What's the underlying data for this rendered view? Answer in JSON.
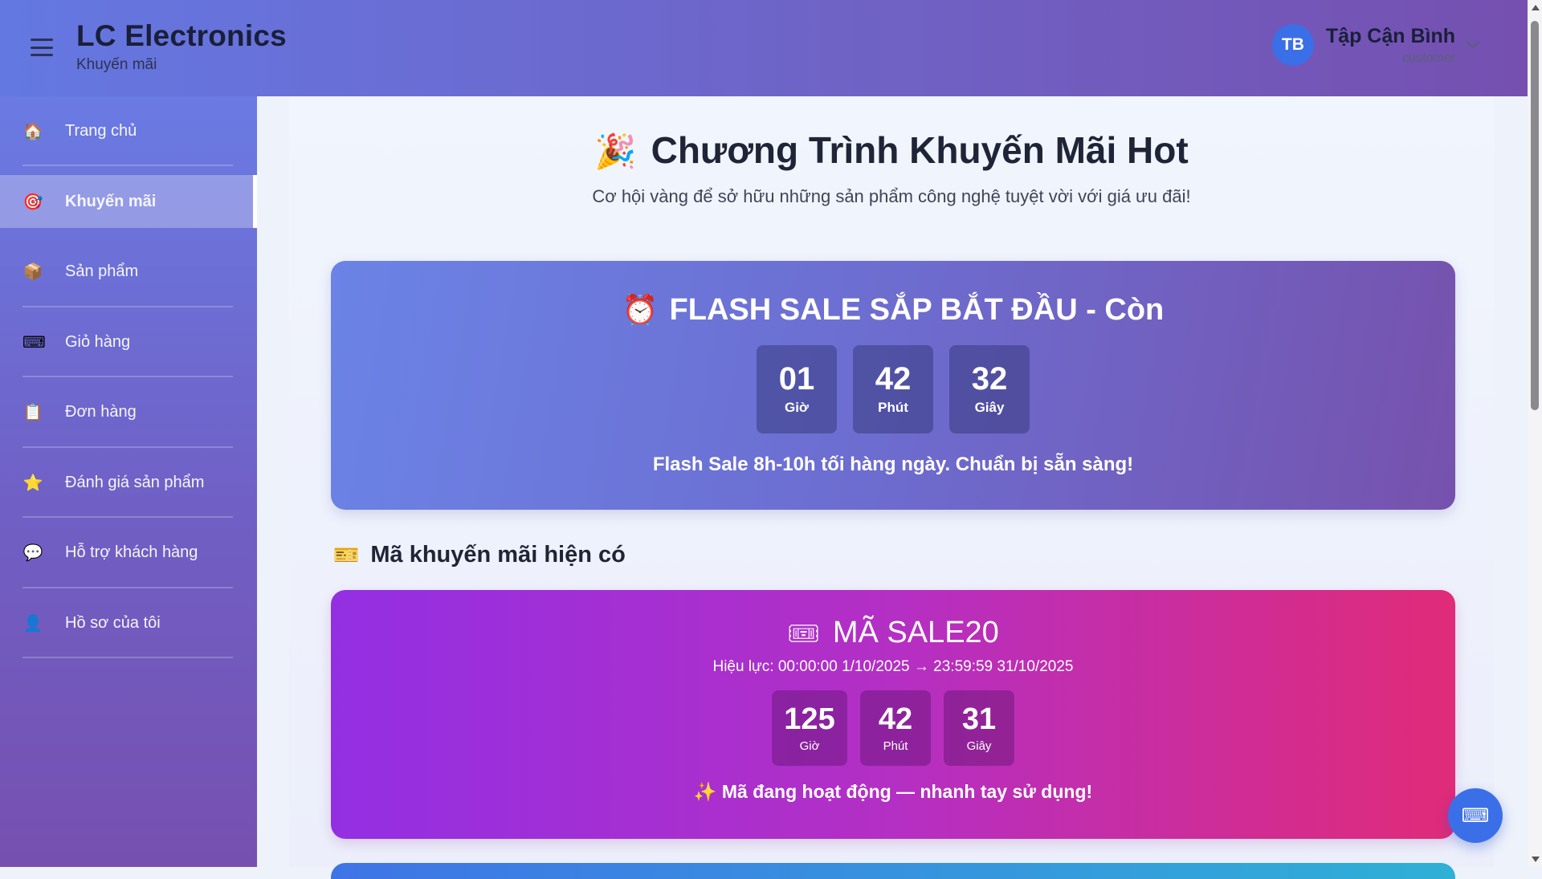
{
  "header": {
    "brand_title": "LC Electronics",
    "brand_subtitle": "Khuyến mãi",
    "user": {
      "initials": "TB",
      "name": "Tập Cận Bình",
      "role": "customer"
    }
  },
  "sidebar": {
    "items": [
      {
        "label": "Trang chủ",
        "icon": "🏠",
        "active": false
      },
      {
        "label": "Khuyến mãi",
        "icon": "🎯",
        "active": true
      },
      {
        "label": "Sản phẩm",
        "icon": "📦",
        "active": false
      },
      {
        "label": "Giỏ hàng",
        "icon": "⌨",
        "active": false
      },
      {
        "label": "Đơn hàng",
        "icon": "📋",
        "active": false
      },
      {
        "label": "Đánh giá sản phẩm",
        "icon": "⭐",
        "active": false
      },
      {
        "label": "Hỗ trợ khách hàng",
        "icon": "💬",
        "active": false
      },
      {
        "label": "Hồ sơ của tôi",
        "icon": "👤",
        "active": false
      }
    ]
  },
  "main": {
    "title_icon": "🎉",
    "title": "Chương Trình Khuyến Mãi Hot",
    "subtitle": "Cơ hội vàng để sở hữu những sản phẩm công nghệ tuyệt vời với giá ưu đãi!",
    "flash_sale": {
      "icon": "⏰",
      "title": "FLASH SALE SẮP BẮT ĐẦU - Còn",
      "timer": [
        {
          "value": "01",
          "unit": "Giờ"
        },
        {
          "value": "42",
          "unit": "Phút"
        },
        {
          "value": "32",
          "unit": "Giây"
        }
      ],
      "note": "Flash Sale 8h-10h tối hàng ngày. Chuẩn bị sẵn sàng!"
    },
    "coupons_section": {
      "icon": "🎫",
      "title": "Mã khuyến mãi hiện có"
    },
    "coupon": {
      "icon": "🎟",
      "title": "MÃ SALE20",
      "validity": "Hiệu lực: 00:00:00 1/10/2025 → 23:59:59 31/10/2025",
      "timer": [
        {
          "value": "125",
          "unit": "Giờ"
        },
        {
          "value": "42",
          "unit": "Phút"
        },
        {
          "value": "31",
          "unit": "Giây"
        }
      ],
      "note_icon": "✨",
      "note": "Mã đang hoạt động — nhanh tay sử dụng!"
    }
  },
  "floating_button": {
    "icon": "⌨"
  },
  "colors": {
    "accent": "#3b6fe8",
    "header_gradient_start": "#6478e2",
    "header_gradient_end": "#7550b0",
    "flash_card_start": "#6b83e6",
    "flash_card_end": "#7652ad",
    "coupon_card_start": "#932fe3",
    "coupon_card_end": "#e02b78"
  }
}
